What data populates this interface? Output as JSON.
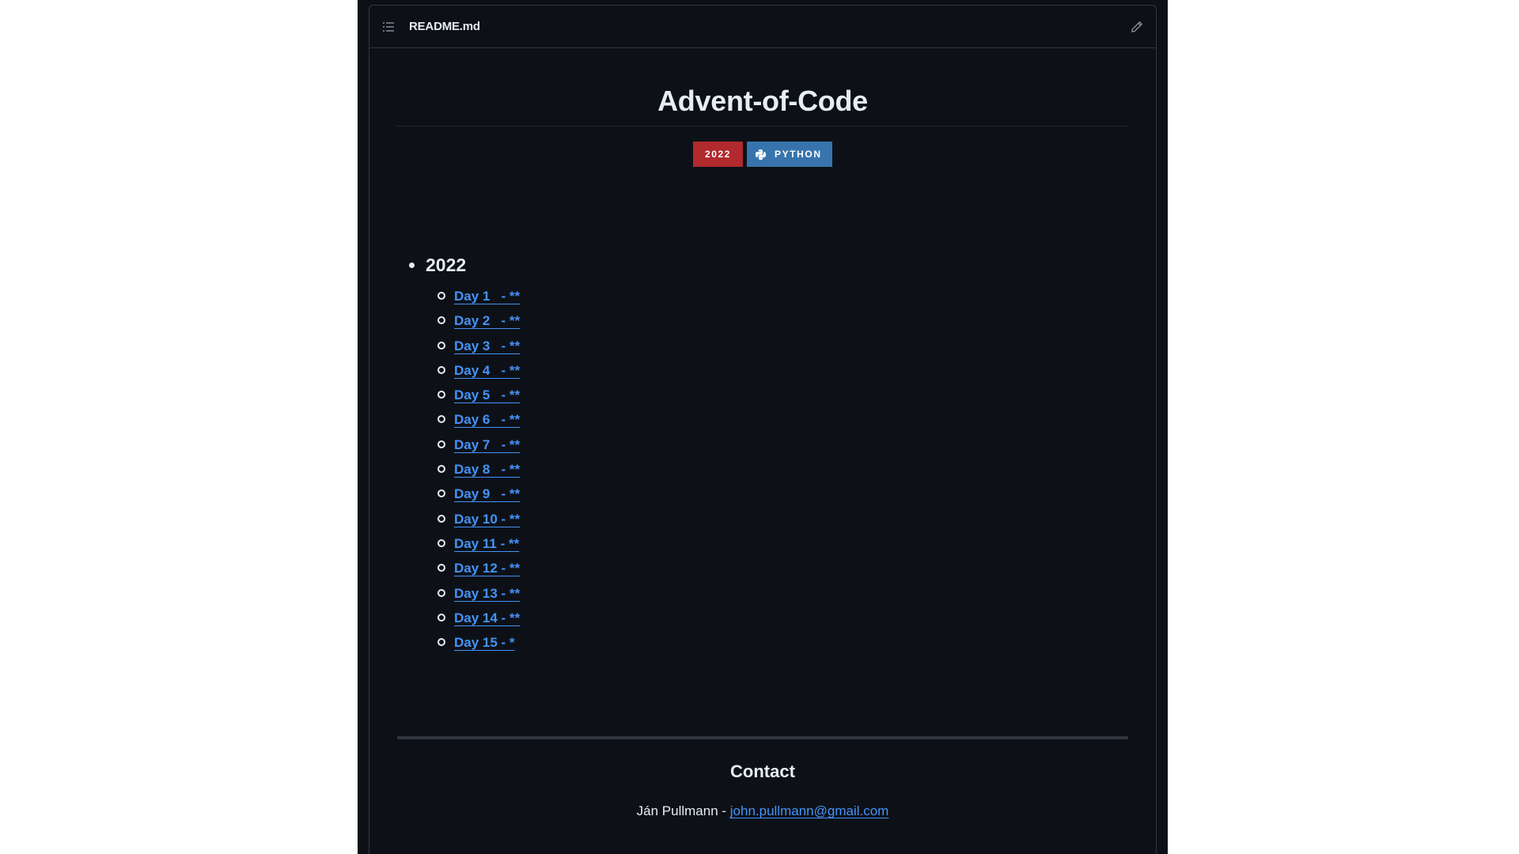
{
  "header": {
    "filename": "README.md",
    "list_icon": "list-unordered-icon",
    "edit_icon": "pencil-icon"
  },
  "readme": {
    "title": "Advent-of-Code",
    "badges": [
      {
        "label": "2022",
        "color": "#b12a2d"
      },
      {
        "label": "PYTHON",
        "color": "#3774ad",
        "icon": "python-icon"
      }
    ],
    "years": [
      {
        "label": "2022",
        "days": [
          "Day 1   - **",
          "Day 2   - **",
          "Day 3   - **",
          "Day 4   - **",
          "Day 5   - **",
          "Day 6   - **",
          "Day 7   - **",
          "Day 8   - **",
          "Day 9   - **",
          "Day 10 - **",
          "Day 11 - **",
          "Day 12 - **",
          "Day 13 - **",
          "Day 14 - **",
          "Day 15 - *"
        ]
      }
    ],
    "contact": {
      "heading": "Contact",
      "name": "Ján Pullmann - ",
      "email": "john.pullmann@gmail.com"
    }
  },
  "colors": {
    "background": "#0d1117",
    "border": "#30363d",
    "text": "#e6edf3",
    "link": "#4493f8"
  }
}
